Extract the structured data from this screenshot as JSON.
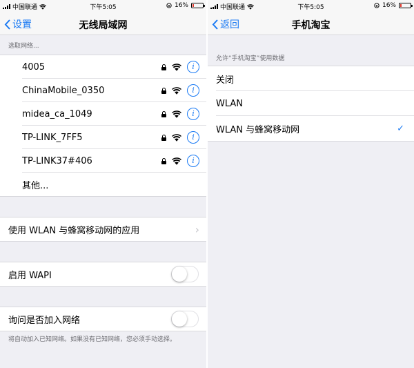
{
  "status_bar": {
    "carrier": "中国联通",
    "time": "下午5:05",
    "battery_text": "16%",
    "battery_level": 0.16
  },
  "left": {
    "nav": {
      "back_label": "设置",
      "title": "无线局域网"
    },
    "networks_label": "选取网络...",
    "networks": [
      {
        "name": "4005"
      },
      {
        "name": "ChinaMobile_0350"
      },
      {
        "name": "midea_ca_1049"
      },
      {
        "name": "TP-LINK_7FF5"
      },
      {
        "name": "TP-LINK37#406"
      }
    ],
    "other_label": "其他...",
    "apps_label": "使用 WLAN 与蜂窝移动网的应用",
    "wapi_label": "启用 WAPI",
    "wapi_on": false,
    "ask_label": "询问是否加入网络",
    "ask_on": false,
    "ask_footnote": "将自动加入已知网络。如果没有已知网络，您必须手动选择。"
  },
  "right": {
    "nav": {
      "back_label": "返回",
      "title": "手机淘宝"
    },
    "section_label": "允许“手机淘宝”使用数据",
    "options": [
      {
        "label": "关闭",
        "selected": false
      },
      {
        "label": "WLAN",
        "selected": false
      },
      {
        "label": "WLAN 与蜂窝移动网",
        "selected": true
      }
    ]
  },
  "colors": {
    "accent": "#1a7af4",
    "background": "#efeff4",
    "battery_low": "#e03c31"
  },
  "icons": {
    "lock": "lock-icon",
    "wifi": "wifi-icon",
    "info": "info-icon",
    "back": "chevron-left-icon",
    "disclosure": "chevron-right-icon",
    "checkmark": "checkmark-icon"
  }
}
